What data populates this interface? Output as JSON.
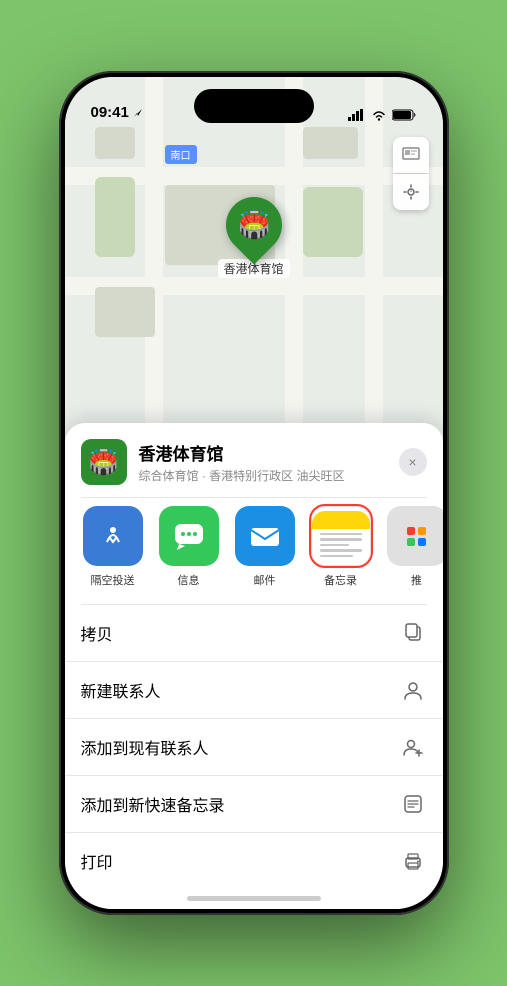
{
  "phone": {
    "status_bar": {
      "time": "09:41",
      "location_arrow": true
    }
  },
  "map": {
    "road_label": "南口",
    "road_label_prefix": "南口"
  },
  "venue": {
    "name": "香港体育馆",
    "subtitle": "综合体育馆 · 香港特别行政区 油尖旺区",
    "pin_label": "香港体育馆"
  },
  "share_items": [
    {
      "id": "airdrop",
      "label": "隔空投送",
      "selected": false
    },
    {
      "id": "message",
      "label": "信息",
      "selected": false
    },
    {
      "id": "mail",
      "label": "邮件",
      "selected": false
    },
    {
      "id": "notes",
      "label": "备忘录",
      "selected": true
    },
    {
      "id": "more",
      "label": "推",
      "selected": false
    }
  ],
  "actions": [
    {
      "id": "copy",
      "label": "拷贝",
      "icon": "copy"
    },
    {
      "id": "new-contact",
      "label": "新建联系人",
      "icon": "person"
    },
    {
      "id": "add-existing",
      "label": "添加到现有联系人",
      "icon": "person-add"
    },
    {
      "id": "add-notes",
      "label": "添加到新快速备忘录",
      "icon": "note"
    },
    {
      "id": "print",
      "label": "打印",
      "icon": "printer"
    }
  ],
  "close_label": "×"
}
